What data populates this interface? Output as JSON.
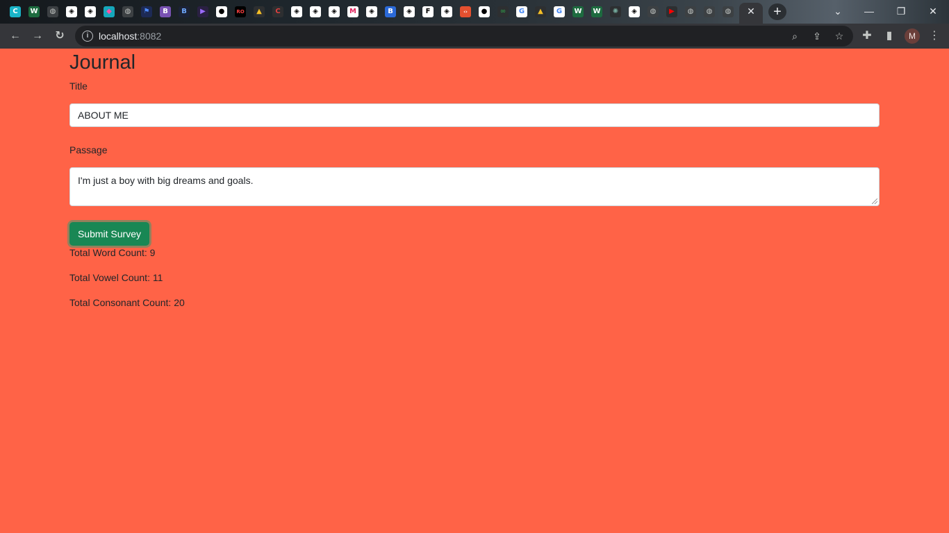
{
  "browser": {
    "tabs": [
      {
        "icon": "canva-icon",
        "glyph": "C",
        "bg": "#1ab4c8",
        "fg": "#ffffff"
      },
      {
        "icon": "webflow-w-icon",
        "glyph": "W",
        "bg": "#1d6b3f",
        "fg": "#ffffff"
      },
      {
        "icon": "globe-icon",
        "glyph": "◍",
        "bg": "#3c4043",
        "fg": "#c4c7c5"
      },
      {
        "icon": "codepen-icon",
        "glyph": "◈",
        "bg": "#ffffff",
        "fg": "#000000"
      },
      {
        "icon": "codepen-icon",
        "glyph": "◈",
        "bg": "#ffffff",
        "fg": "#000000"
      },
      {
        "icon": "cube-icon",
        "glyph": "◆",
        "bg": "#16a7bb",
        "fg": "#ff4fa3"
      },
      {
        "icon": "globe-icon",
        "glyph": "◍",
        "bg": "#3c4043",
        "fg": "#c4c7c5"
      },
      {
        "icon": "flag-icon",
        "glyph": "⚑",
        "bg": "#1d2a55",
        "fg": "#4d8bff"
      },
      {
        "icon": "bootstrap-icon",
        "glyph": "B",
        "bg": "#7952b3",
        "fg": "#ffffff"
      },
      {
        "icon": "bootstrap-small-icon",
        "glyph": "B",
        "bg": "#1b2235",
        "fg": "#6ea8fe"
      },
      {
        "icon": "play-icon",
        "glyph": "▶",
        "bg": "#2a2042",
        "fg": "#9b6bff"
      },
      {
        "icon": "github-icon",
        "glyph": "●",
        "bg": "#ffffff",
        "fg": "#000000"
      },
      {
        "icon": "ro-icon",
        "glyph": "RO",
        "bg": "#000000",
        "fg": "#ff4040"
      },
      {
        "icon": "google-drive-icon",
        "glyph": "▲",
        "bg": "#2d2f31",
        "fg": "#f6c026"
      },
      {
        "icon": "c-brand-icon",
        "glyph": "C",
        "bg": "#2d2f31",
        "fg": "#e04040"
      },
      {
        "icon": "codepen-icon",
        "glyph": "◈",
        "bg": "#ffffff",
        "fg": "#000000"
      },
      {
        "icon": "codepen-icon",
        "glyph": "◈",
        "bg": "#ffffff",
        "fg": "#000000"
      },
      {
        "icon": "codepen-icon",
        "glyph": "◈",
        "bg": "#ffffff",
        "fg": "#000000"
      },
      {
        "icon": "gmail-icon",
        "glyph": "M",
        "bg": "#ffffff",
        "fg": "#e0245e"
      },
      {
        "icon": "codepen-icon",
        "glyph": "◈",
        "bg": "#ffffff",
        "fg": "#000000"
      },
      {
        "icon": "bootstrap-blue-icon",
        "glyph": "B",
        "bg": "#2b6ad8",
        "fg": "#ffffff"
      },
      {
        "icon": "codepen-icon",
        "glyph": "◈",
        "bg": "#ffffff",
        "fg": "#000000"
      },
      {
        "icon": "frame-icon",
        "glyph": "F",
        "bg": "#ffffff",
        "fg": "#000000"
      },
      {
        "icon": "codepen-icon",
        "glyph": "◈",
        "bg": "#ffffff",
        "fg": "#000000"
      },
      {
        "icon": "code-icon",
        "glyph": "‹›",
        "bg": "#e4502f",
        "fg": "#ffffff"
      },
      {
        "icon": "github-icon",
        "glyph": "●",
        "bg": "#ffffff",
        "fg": "#000000"
      },
      {
        "icon": "geeks-icon",
        "glyph": "∞",
        "bg": "#2d2f31",
        "fg": "#2f8d46"
      },
      {
        "icon": "google-icon",
        "glyph": "G",
        "bg": "#ffffff",
        "fg": "#4285f4"
      },
      {
        "icon": "google-drive-icon",
        "glyph": "▲",
        "bg": "#2d2f31",
        "fg": "#f6c026"
      },
      {
        "icon": "google-icon",
        "glyph": "G",
        "bg": "#ffffff",
        "fg": "#4285f4"
      },
      {
        "icon": "webflow-w-icon",
        "glyph": "W",
        "bg": "#1d6b3f",
        "fg": "#ffffff"
      },
      {
        "icon": "webflow-w-icon",
        "glyph": "W",
        "bg": "#1d6b3f",
        "fg": "#ffffff"
      },
      {
        "icon": "chatgpt-icon",
        "glyph": "✺",
        "bg": "#2d2f31",
        "fg": "#74aa9c"
      },
      {
        "icon": "codepen-icon",
        "glyph": "◈",
        "bg": "#ffffff",
        "fg": "#000000"
      },
      {
        "icon": "globe-icon",
        "glyph": "◍",
        "bg": "#3c4043",
        "fg": "#c4c7c5"
      },
      {
        "icon": "youtube-icon",
        "glyph": "▶",
        "bg": "#2d2f31",
        "fg": "#ff0000"
      },
      {
        "icon": "globe-icon",
        "glyph": "◍",
        "bg": "#3c4043",
        "fg": "#c4c7c5"
      },
      {
        "icon": "globe-icon",
        "glyph": "◍",
        "bg": "#3c4043",
        "fg": "#c4c7c5"
      },
      {
        "icon": "globe-icon",
        "glyph": "◍",
        "bg": "#3c4043",
        "fg": "#c4c7c5"
      }
    ],
    "url_host": "localhost",
    "url_port": ":8082",
    "profile_initial": "M"
  },
  "page": {
    "background": "#ff6347",
    "heading": "Journal",
    "title_label": "Title",
    "title_value": "ABOUT ME",
    "passage_label": "Passage",
    "passage_value": "I'm just a boy with big dreams and goals.",
    "submit_label": "Submit Survey",
    "submit_color": "#198754",
    "stats": {
      "word_count": "Total Word Count: 9",
      "vowel_count": "Total Vowel Count: 11",
      "consonant_count": "Total Consonant Count: 20"
    }
  }
}
